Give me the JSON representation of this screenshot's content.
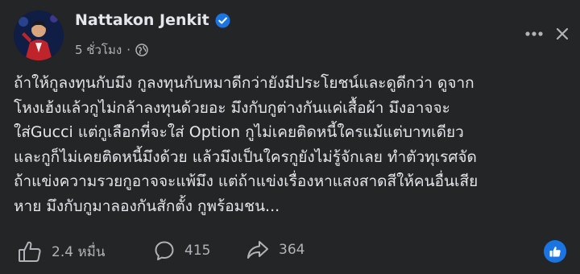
{
  "post": {
    "author_name": "Nattakon Jenkit",
    "timestamp": "5 ชั่วโมง",
    "separator": "·",
    "privacy_icon": "globe-icon",
    "verified_icon": "verified-badge-icon",
    "text_lines": [
      "ถ้าให้กูลงทุนกับมึง กูลงทุนกับหมาดีกว่ายังมีประโยชน์และดูดีกว่า ดูจาก",
      "โหงเฮ้งแล้วกูไม่กล้าลงทุนด้วยอะ มึงกับกูต่างกันแค่เสื้อผ้า มึงอาจจะ",
      "ใส่Gucci แต่กูเลือกที่จะใส่ Option กูไม่เคยติดหนี้ใครแม้แต่บาทเดียว",
      "และกูก็ไม่เคยติดหนี้มึงด้วย แล้วมึงเป็นใครกูยังไม่รู้จักเลย ทำตัวทุเรศจัด",
      "ถ้าแข่งความรวยกูอาจจะแพ้มึง แต่ถ้าแข่งเรื่องหาแสงสาดสีให้คนอื่นเสีย",
      "หาย มึงกับกูมาลองกันสักตั้ง กูพร้อมชน..."
    ]
  },
  "stats": {
    "likes": "2.4 หมื่น",
    "comments": "415",
    "shares": "364"
  },
  "colors": {
    "background": "#242526",
    "text_primary": "#e4e6eb",
    "text_secondary": "#b0b3b8",
    "accent": "#1b74e4"
  }
}
